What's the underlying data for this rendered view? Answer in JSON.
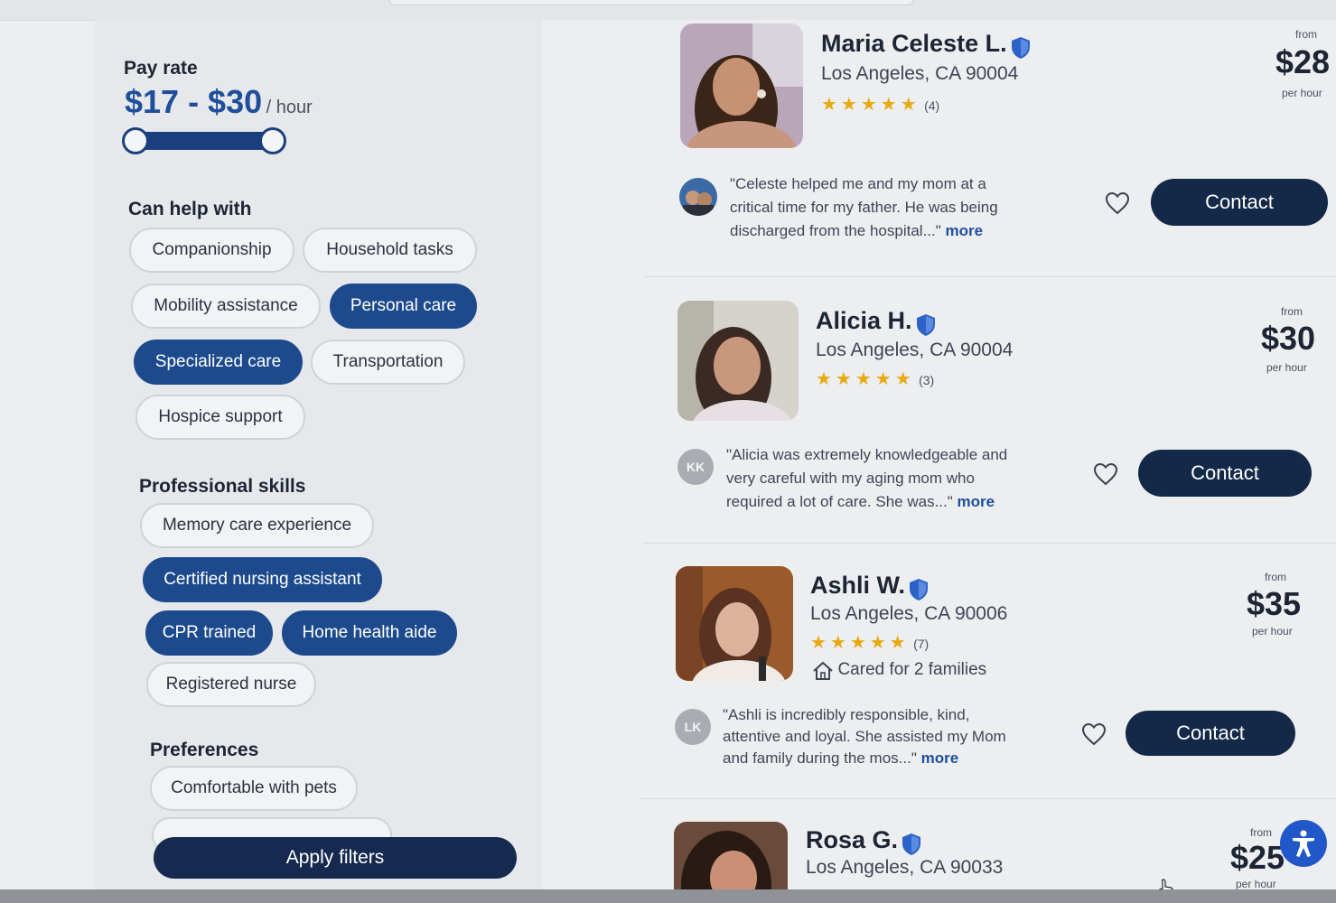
{
  "filters": {
    "pay_rate": {
      "title": "Pay rate",
      "value": "$17 - $30",
      "unit": "/ hour",
      "min": 17,
      "max": 30
    },
    "can_help_with": {
      "title": "Can help with",
      "options": [
        {
          "label": "Companionship",
          "selected": false
        },
        {
          "label": "Household tasks",
          "selected": false
        },
        {
          "label": "Mobility assistance",
          "selected": false
        },
        {
          "label": "Personal care",
          "selected": true
        },
        {
          "label": "Specialized care",
          "selected": true
        },
        {
          "label": "Transportation",
          "selected": false
        },
        {
          "label": "Hospice support",
          "selected": false
        }
      ]
    },
    "professional_skills": {
      "title": "Professional skills",
      "options": [
        {
          "label": "Memory care experience",
          "selected": false
        },
        {
          "label": "Certified nursing assistant",
          "selected": true
        },
        {
          "label": "CPR trained",
          "selected": true
        },
        {
          "label": "Home health aide",
          "selected": true
        },
        {
          "label": "Registered nurse",
          "selected": false
        }
      ]
    },
    "preferences": {
      "title": "Preferences",
      "options": [
        {
          "label": "Comfortable with pets",
          "selected": false
        }
      ]
    },
    "apply_label": "Apply filters"
  },
  "caregivers": [
    {
      "name": "Maria Celeste L.",
      "location": "Los Angeles, CA 90004",
      "stars": "★★★★★",
      "rating": 5,
      "review_count": "(4)",
      "reviewer_initials": "",
      "review": "\"Celeste helped me and my mom at a critical time for my father. He was being discharged from the hospital...\"",
      "more": "more",
      "contact": "Contact",
      "price_from": "from",
      "price": "$28",
      "price_per": "per hour"
    },
    {
      "name": "Alicia H.",
      "location": "Los Angeles, CA 90004",
      "stars": "★★★★★",
      "rating": 5,
      "review_count": "(3)",
      "reviewer_initials": "KK",
      "review": "\"Alicia was extremely knowledgeable and very careful with my aging mom who required a lot of care. She was...\"",
      "more": "more",
      "contact": "Contact",
      "price_from": "from",
      "price": "$30",
      "price_per": "per hour"
    },
    {
      "name": "Ashli W.",
      "location": "Los Angeles, CA 90006",
      "stars": "★★★★★",
      "rating": 5,
      "review_count": "(7)",
      "cared_for": "Cared for 2 families",
      "reviewer_initials": "LK",
      "review": "\"Ashli is incredibly responsible, kind, attentive and loyal. She assisted my Mom and family during the mos...\"",
      "more": "more",
      "contact": "Contact",
      "price_from": "from",
      "price": "$35",
      "price_per": "per hour"
    },
    {
      "name": "Rosa G.",
      "location": "Los Angeles, CA 90033",
      "price_from": "from",
      "price": "$25",
      "price_per": "per hour"
    }
  ],
  "colors": {
    "accent": "#1d4a8c",
    "button_dark": "#142848",
    "star": "#e9a912"
  }
}
